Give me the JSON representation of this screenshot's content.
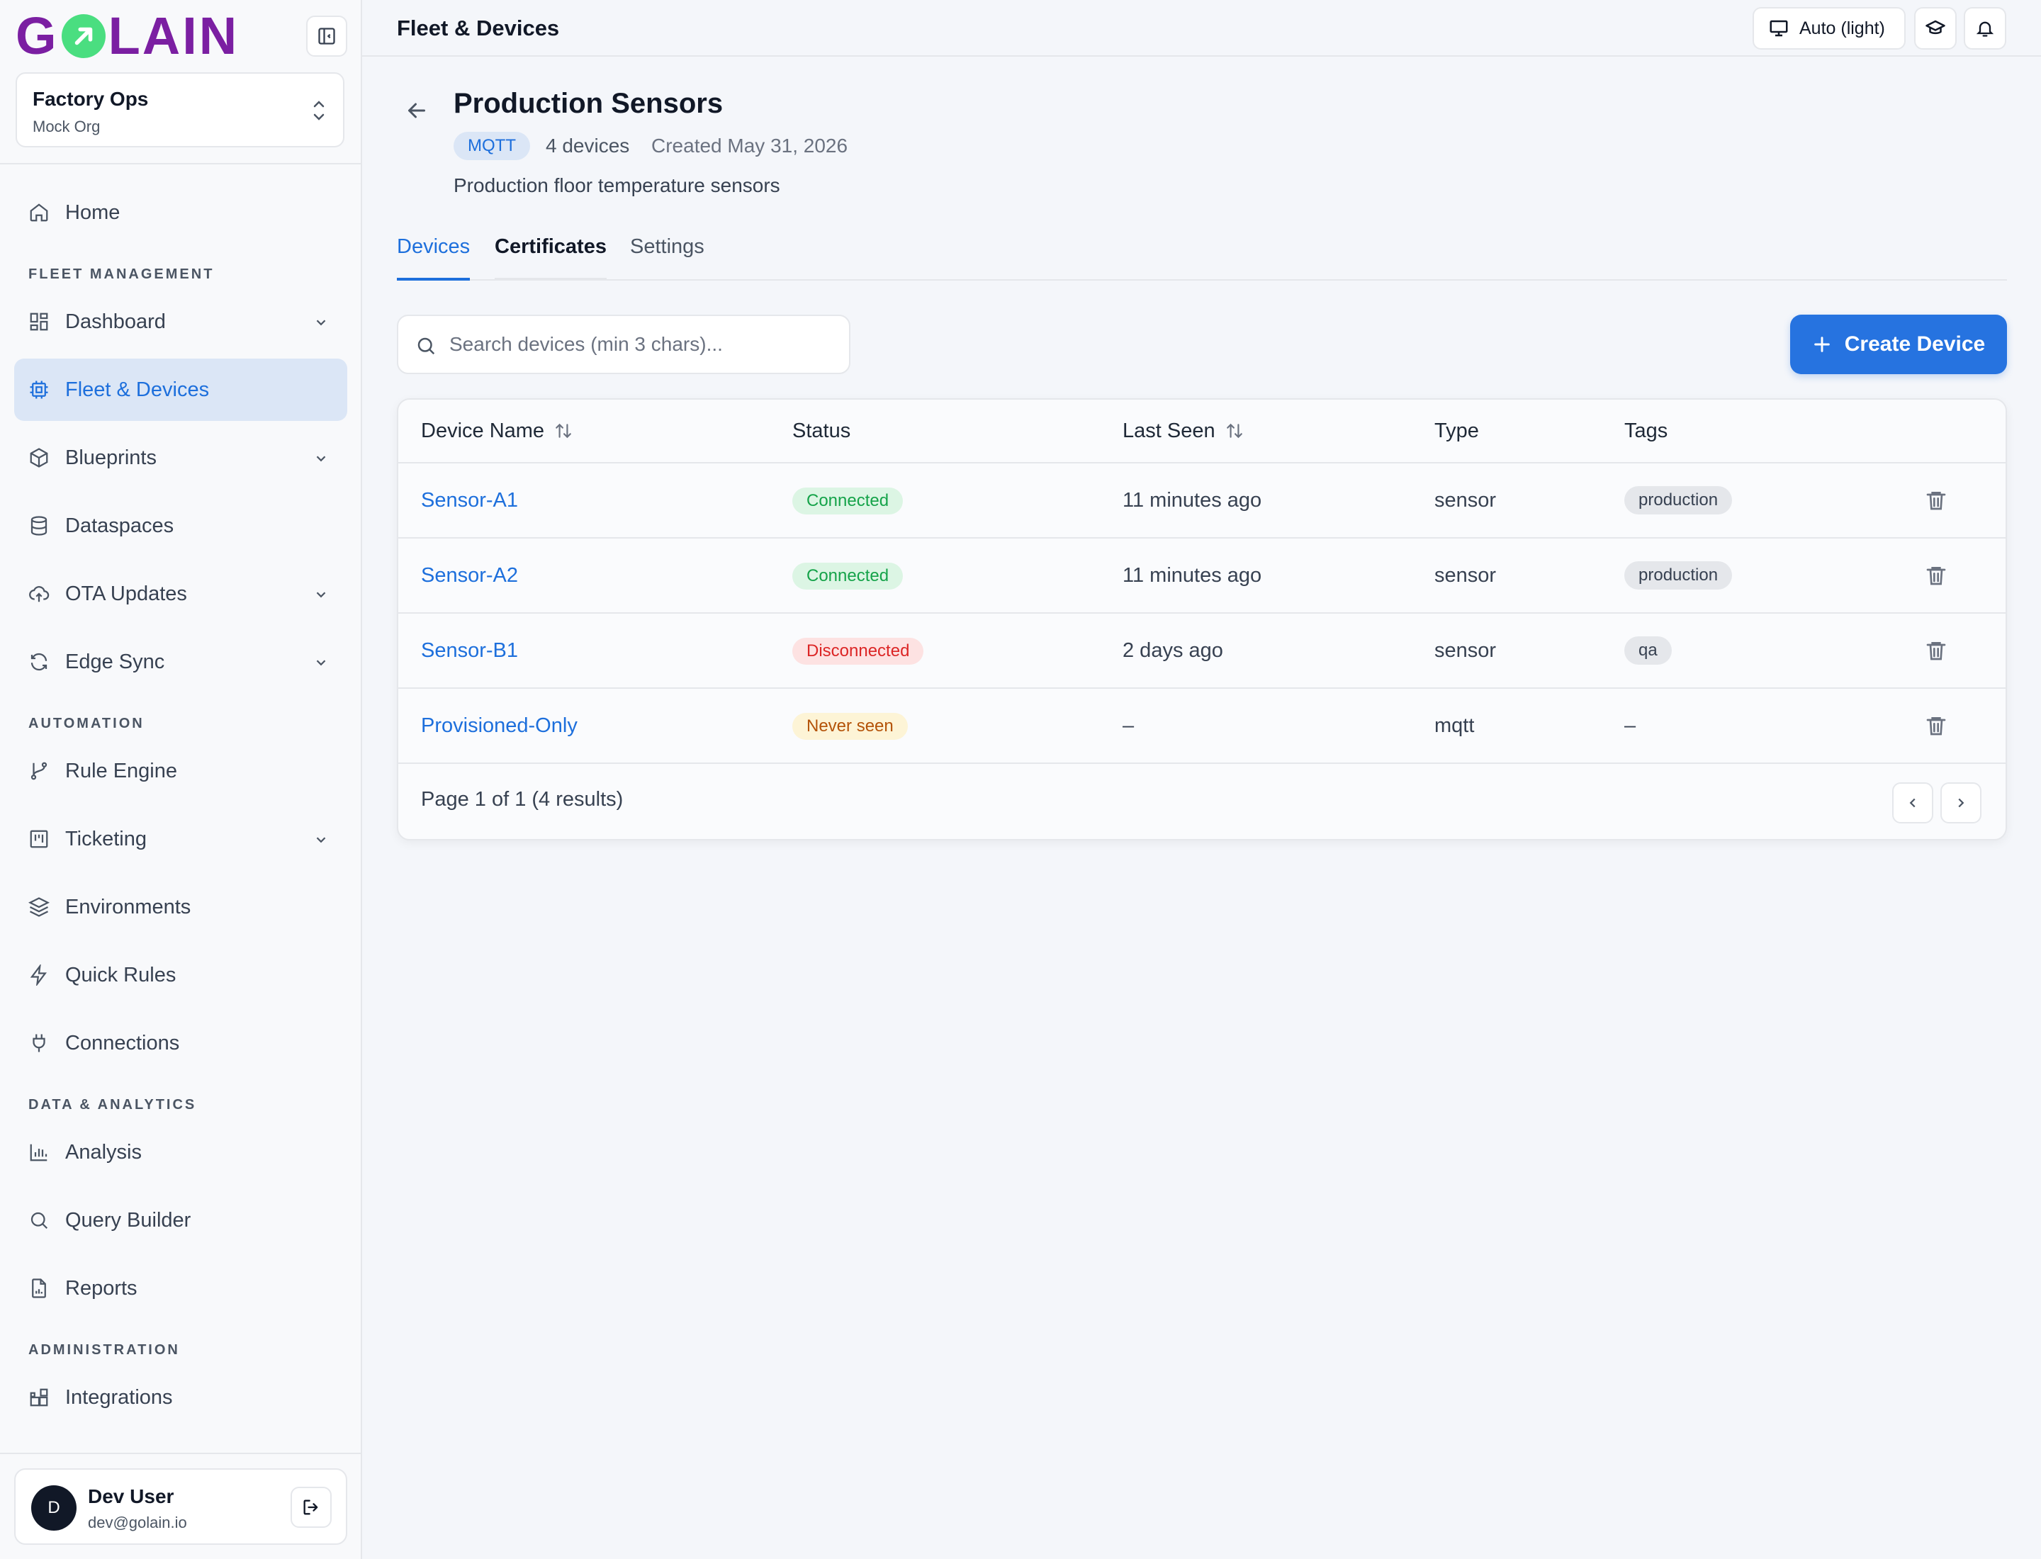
{
  "app": {
    "logo_text": "GOLAIN",
    "brand_color": "#7b1fa2",
    "accent_color": "#1d6fdc"
  },
  "org": {
    "name": "Factory Ops",
    "subtitle": "Mock Org"
  },
  "sidebar": {
    "items": [
      {
        "label": "Home",
        "icon": "home-icon"
      },
      {
        "section": "FLEET MANAGEMENT"
      },
      {
        "label": "Dashboard",
        "icon": "dashboard-icon",
        "expandable": true
      },
      {
        "label": "Fleet & Devices",
        "icon": "chip-icon",
        "active": true
      },
      {
        "label": "Blueprints",
        "icon": "cube-icon",
        "expandable": true
      },
      {
        "label": "Dataspaces",
        "icon": "database-icon"
      },
      {
        "label": "OTA Updates",
        "icon": "cloud-upload-icon",
        "expandable": true
      },
      {
        "label": "Edge Sync",
        "icon": "sync-icon",
        "expandable": true
      },
      {
        "section": "AUTOMATION"
      },
      {
        "label": "Rule Engine",
        "icon": "git-branch-icon"
      },
      {
        "label": "Ticketing",
        "icon": "kanban-icon",
        "expandable": true
      },
      {
        "label": "Environments",
        "icon": "layers-icon"
      },
      {
        "label": "Quick Rules",
        "icon": "lightning-icon"
      },
      {
        "label": "Connections",
        "icon": "plug-icon"
      },
      {
        "section": "DATA & ANALYTICS"
      },
      {
        "label": "Analysis",
        "icon": "bar-chart-icon"
      },
      {
        "label": "Query Builder",
        "icon": "search-icon"
      },
      {
        "label": "Reports",
        "icon": "report-icon"
      },
      {
        "section": "ADMINISTRATION"
      },
      {
        "label": "Integrations",
        "icon": "integrations-icon"
      }
    ]
  },
  "user": {
    "initial": "D",
    "name": "Dev User",
    "email": "dev@golain.io"
  },
  "topbar": {
    "title": "Fleet & Devices",
    "theme_label": "Auto (light)"
  },
  "fleet": {
    "title": "Production Sensors",
    "protocol": "MQTT",
    "device_count": "4 devices",
    "created": "Created May 31, 2026",
    "description": "Production floor temperature sensors"
  },
  "tabs": [
    "Devices",
    "Certificates",
    "Settings"
  ],
  "search": {
    "placeholder": "Search devices (min 3 chars)..."
  },
  "create_button": "Create Device",
  "table": {
    "columns": [
      "Device Name",
      "Status",
      "Last Seen",
      "Type",
      "Tags"
    ],
    "rows": [
      {
        "name": "Sensor-A1",
        "status": "Connected",
        "status_kind": "connected",
        "last_seen": "11 minutes ago",
        "type": "sensor",
        "tag": "production"
      },
      {
        "name": "Sensor-A2",
        "status": "Connected",
        "status_kind": "connected",
        "last_seen": "11 minutes ago",
        "type": "sensor",
        "tag": "production"
      },
      {
        "name": "Sensor-B1",
        "status": "Disconnected",
        "status_kind": "disconnected",
        "last_seen": "2 days ago",
        "type": "sensor",
        "tag": "qa"
      },
      {
        "name": "Provisioned-Only",
        "status": "Never seen",
        "status_kind": "never",
        "last_seen": "–",
        "type": "mqtt",
        "tag": "–"
      }
    ],
    "pagination": "Page 1 of 1 (4 results)"
  }
}
